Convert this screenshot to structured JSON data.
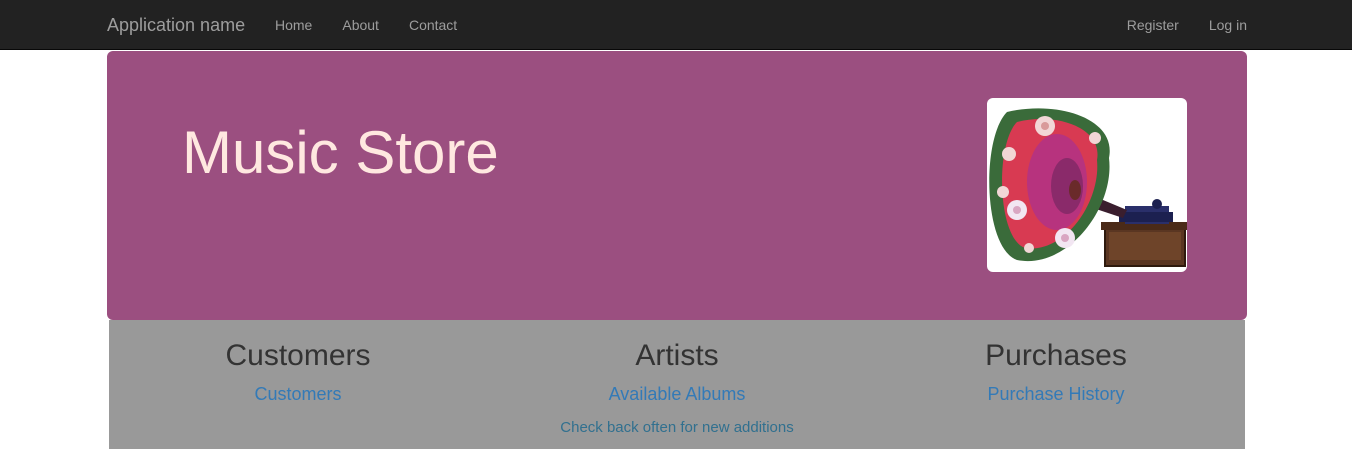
{
  "navbar": {
    "brand": "Application name",
    "left_links": [
      "Home",
      "About",
      "Contact"
    ],
    "right_links": [
      "Register",
      "Log in"
    ]
  },
  "jumbotron": {
    "title": "Music Store",
    "image_icon": "gramophone-icon"
  },
  "sections": [
    {
      "heading": "Customers",
      "link": "Customers"
    },
    {
      "heading": "Artists",
      "link": "Available Albums"
    },
    {
      "heading": "Purchases",
      "link": "Purchase History"
    }
  ],
  "note": "Check back often for new additions",
  "colors": {
    "navbar_bg": "#222222",
    "nav_text": "#9d9d9d",
    "jumbotron_bg": "#9b4f80",
    "title_text": "#ffe8e0",
    "panel_bg": "#999999",
    "link": "#337ab7",
    "note_text": "#31708f"
  }
}
